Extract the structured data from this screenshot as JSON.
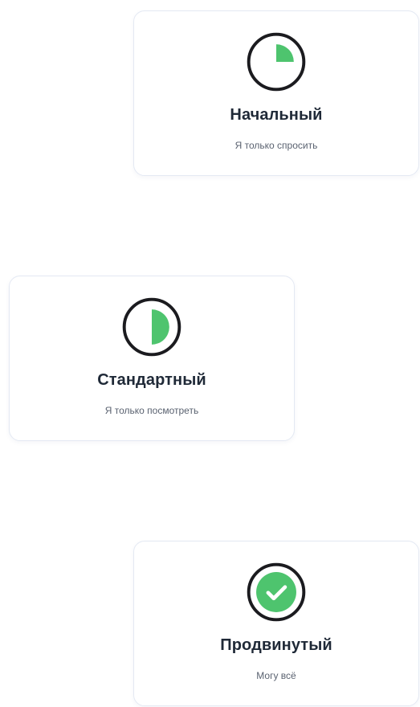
{
  "levels": [
    {
      "title": "Начальный",
      "subtitle": "Я только спросить",
      "icon": "progress-quarter-icon",
      "progress": 0.25
    },
    {
      "title": "Стандартный",
      "subtitle": "Я только посмотреть",
      "icon": "progress-half-icon",
      "progress": 0.5
    },
    {
      "title": "Продвинутый",
      "subtitle": "Могу всё",
      "icon": "check-circle-icon",
      "progress": 1
    }
  ],
  "colors": {
    "accent_green": "#4ec46e",
    "icon_outline": "#1b1b1f",
    "title_text": "#1f2937",
    "subtitle_text": "#5a6270",
    "card_border": "#e4e9f3"
  }
}
